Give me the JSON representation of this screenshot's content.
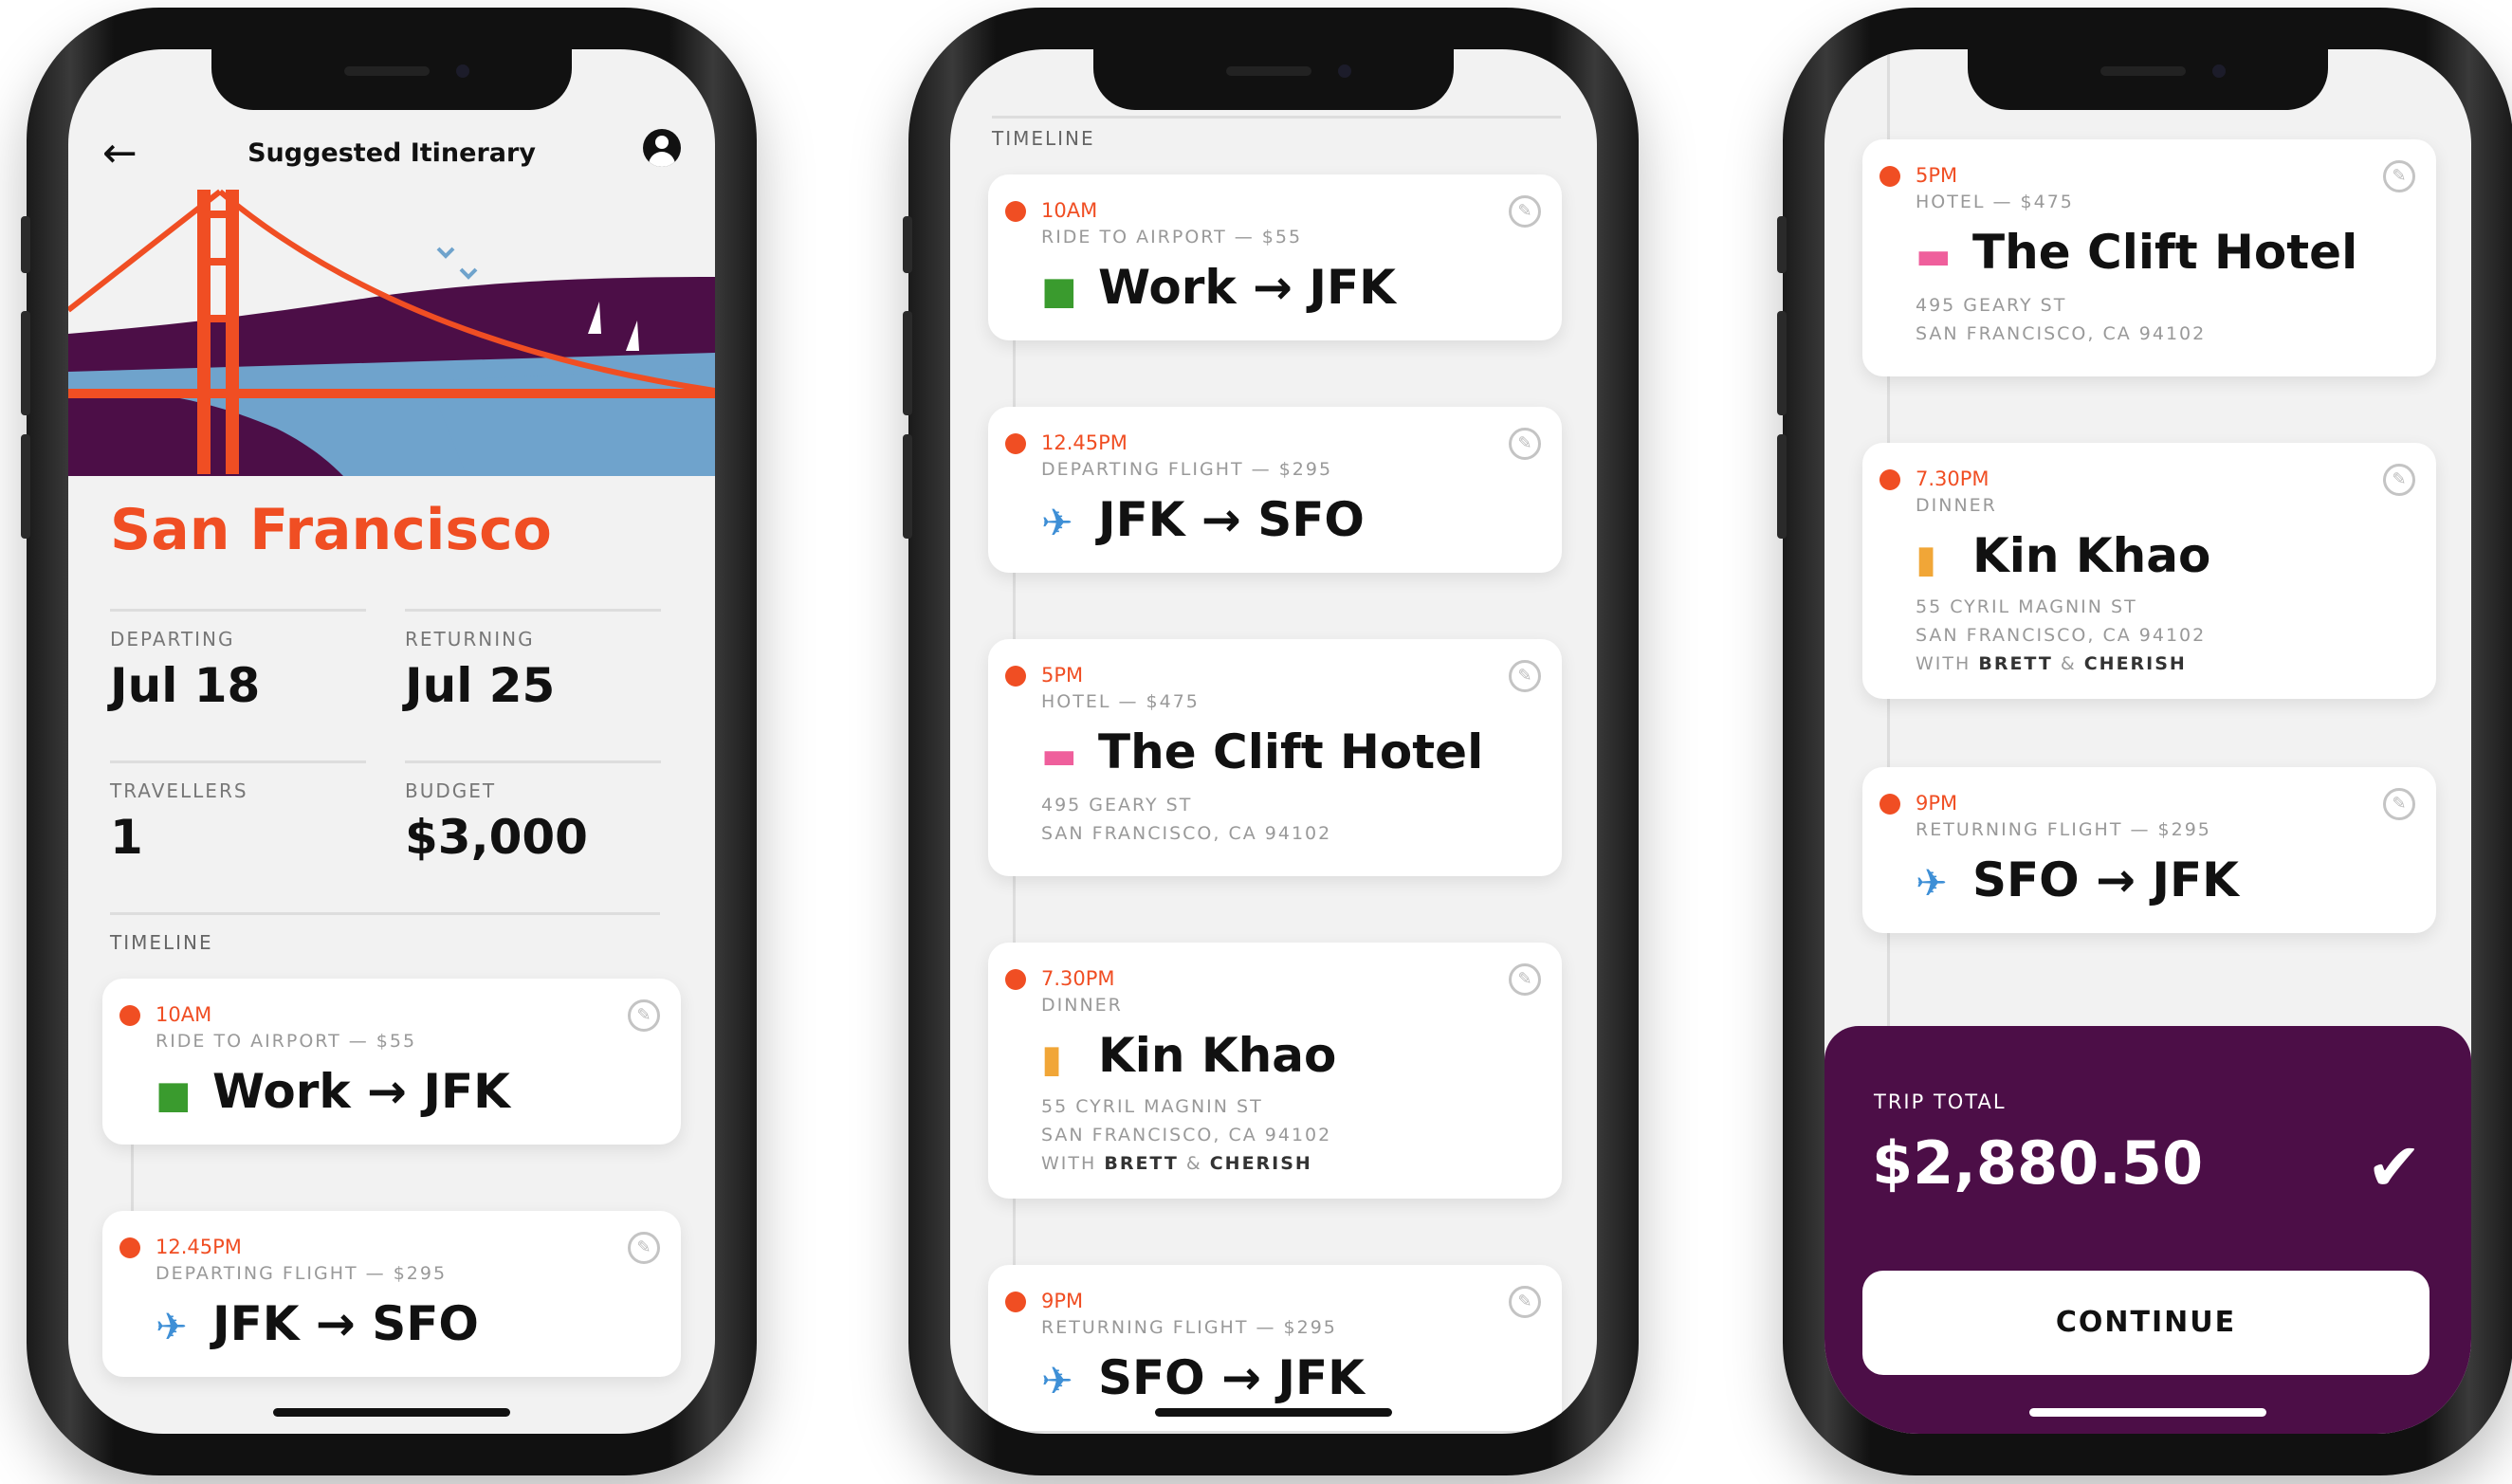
{
  "colors": {
    "accent": "#f04e23",
    "purple": "#4c0e47",
    "car": "#3a9b2e",
    "plane": "#3e8fd6",
    "hotel": "#ef5f9c",
    "dinner": "#f1a637"
  },
  "p1": {
    "header": {
      "back_icon": "arrow-left-icon",
      "title": "Suggested Itinerary",
      "profile_icon": "user-circle-icon"
    },
    "city": "San Francisco",
    "departing": {
      "label": "DEPARTING",
      "value": "Jul 18"
    },
    "returning": {
      "label": "RETURNING",
      "value": "Jul 25"
    },
    "travellers": {
      "label": "TRAVELLERS",
      "value": "1"
    },
    "budget": {
      "label": "BUDGET",
      "value": "$3,000"
    },
    "timeline_label": "TIMELINE",
    "cards": [
      {
        "time": "10AM",
        "meta": "RIDE TO AIRPORT — $55",
        "icon": "car-icon",
        "from": "Work",
        "to": "JFK"
      },
      {
        "time": "12.45PM",
        "meta": "DEPARTING FLIGHT — $295",
        "icon": "plane-icon",
        "from": "JFK",
        "to": "SFO"
      }
    ]
  },
  "p2": {
    "timeline_label": "TIMELINE",
    "cards": [
      {
        "time": "10AM",
        "meta": "RIDE TO AIRPORT — $55",
        "icon": "car-icon",
        "from": "Work",
        "to": "JFK"
      },
      {
        "time": "12.45PM",
        "meta": "DEPARTING FLIGHT — $295",
        "icon": "plane-icon",
        "from": "JFK",
        "to": "SFO"
      },
      {
        "time": "5PM",
        "meta": "HOTEL — $475",
        "icon": "bed-icon",
        "name": "The Clift Hotel",
        "addr1": "495 GEARY ST",
        "addr2": "SAN FRANCISCO, CA 94102"
      },
      {
        "time": "7.30PM",
        "meta": "DINNER",
        "icon": "utensils-icon",
        "name": "Kin Khao",
        "addr1": "55 CYRIL MAGNIN ST",
        "addr2": "SAN FRANCISCO, CA 94102",
        "with": "WITH",
        "person1": "BRETT",
        "amp": "&",
        "person2": "CHERISH"
      },
      {
        "time": "9PM",
        "meta": "RETURNING FLIGHT — $295",
        "icon": "plane-icon",
        "from": "SFO",
        "to": "JFK"
      }
    ]
  },
  "p3": {
    "cards": [
      {
        "time": "5PM",
        "meta": "HOTEL — $475",
        "icon": "bed-icon",
        "name": "The Clift Hotel",
        "addr1": "495 GEARY ST",
        "addr2": "SAN FRANCISCO, CA 94102"
      },
      {
        "time": "7.30PM",
        "meta": "DINNER",
        "icon": "utensils-icon",
        "name": "Kin Khao",
        "addr1": "55 CYRIL MAGNIN ST",
        "addr2": "SAN FRANCISCO, CA 94102",
        "with": "WITH",
        "person1": "BRETT",
        "amp": "&",
        "person2": "CHERISH"
      },
      {
        "time": "9PM",
        "meta": "RETURNING FLIGHT — $295",
        "icon": "plane-icon",
        "from": "SFO",
        "to": "JFK"
      }
    ],
    "total": {
      "label": "TRIP TOTAL",
      "value": "$2,880.50",
      "check_icon": "checkmark-icon"
    },
    "continue_label": "CONTINUE"
  }
}
